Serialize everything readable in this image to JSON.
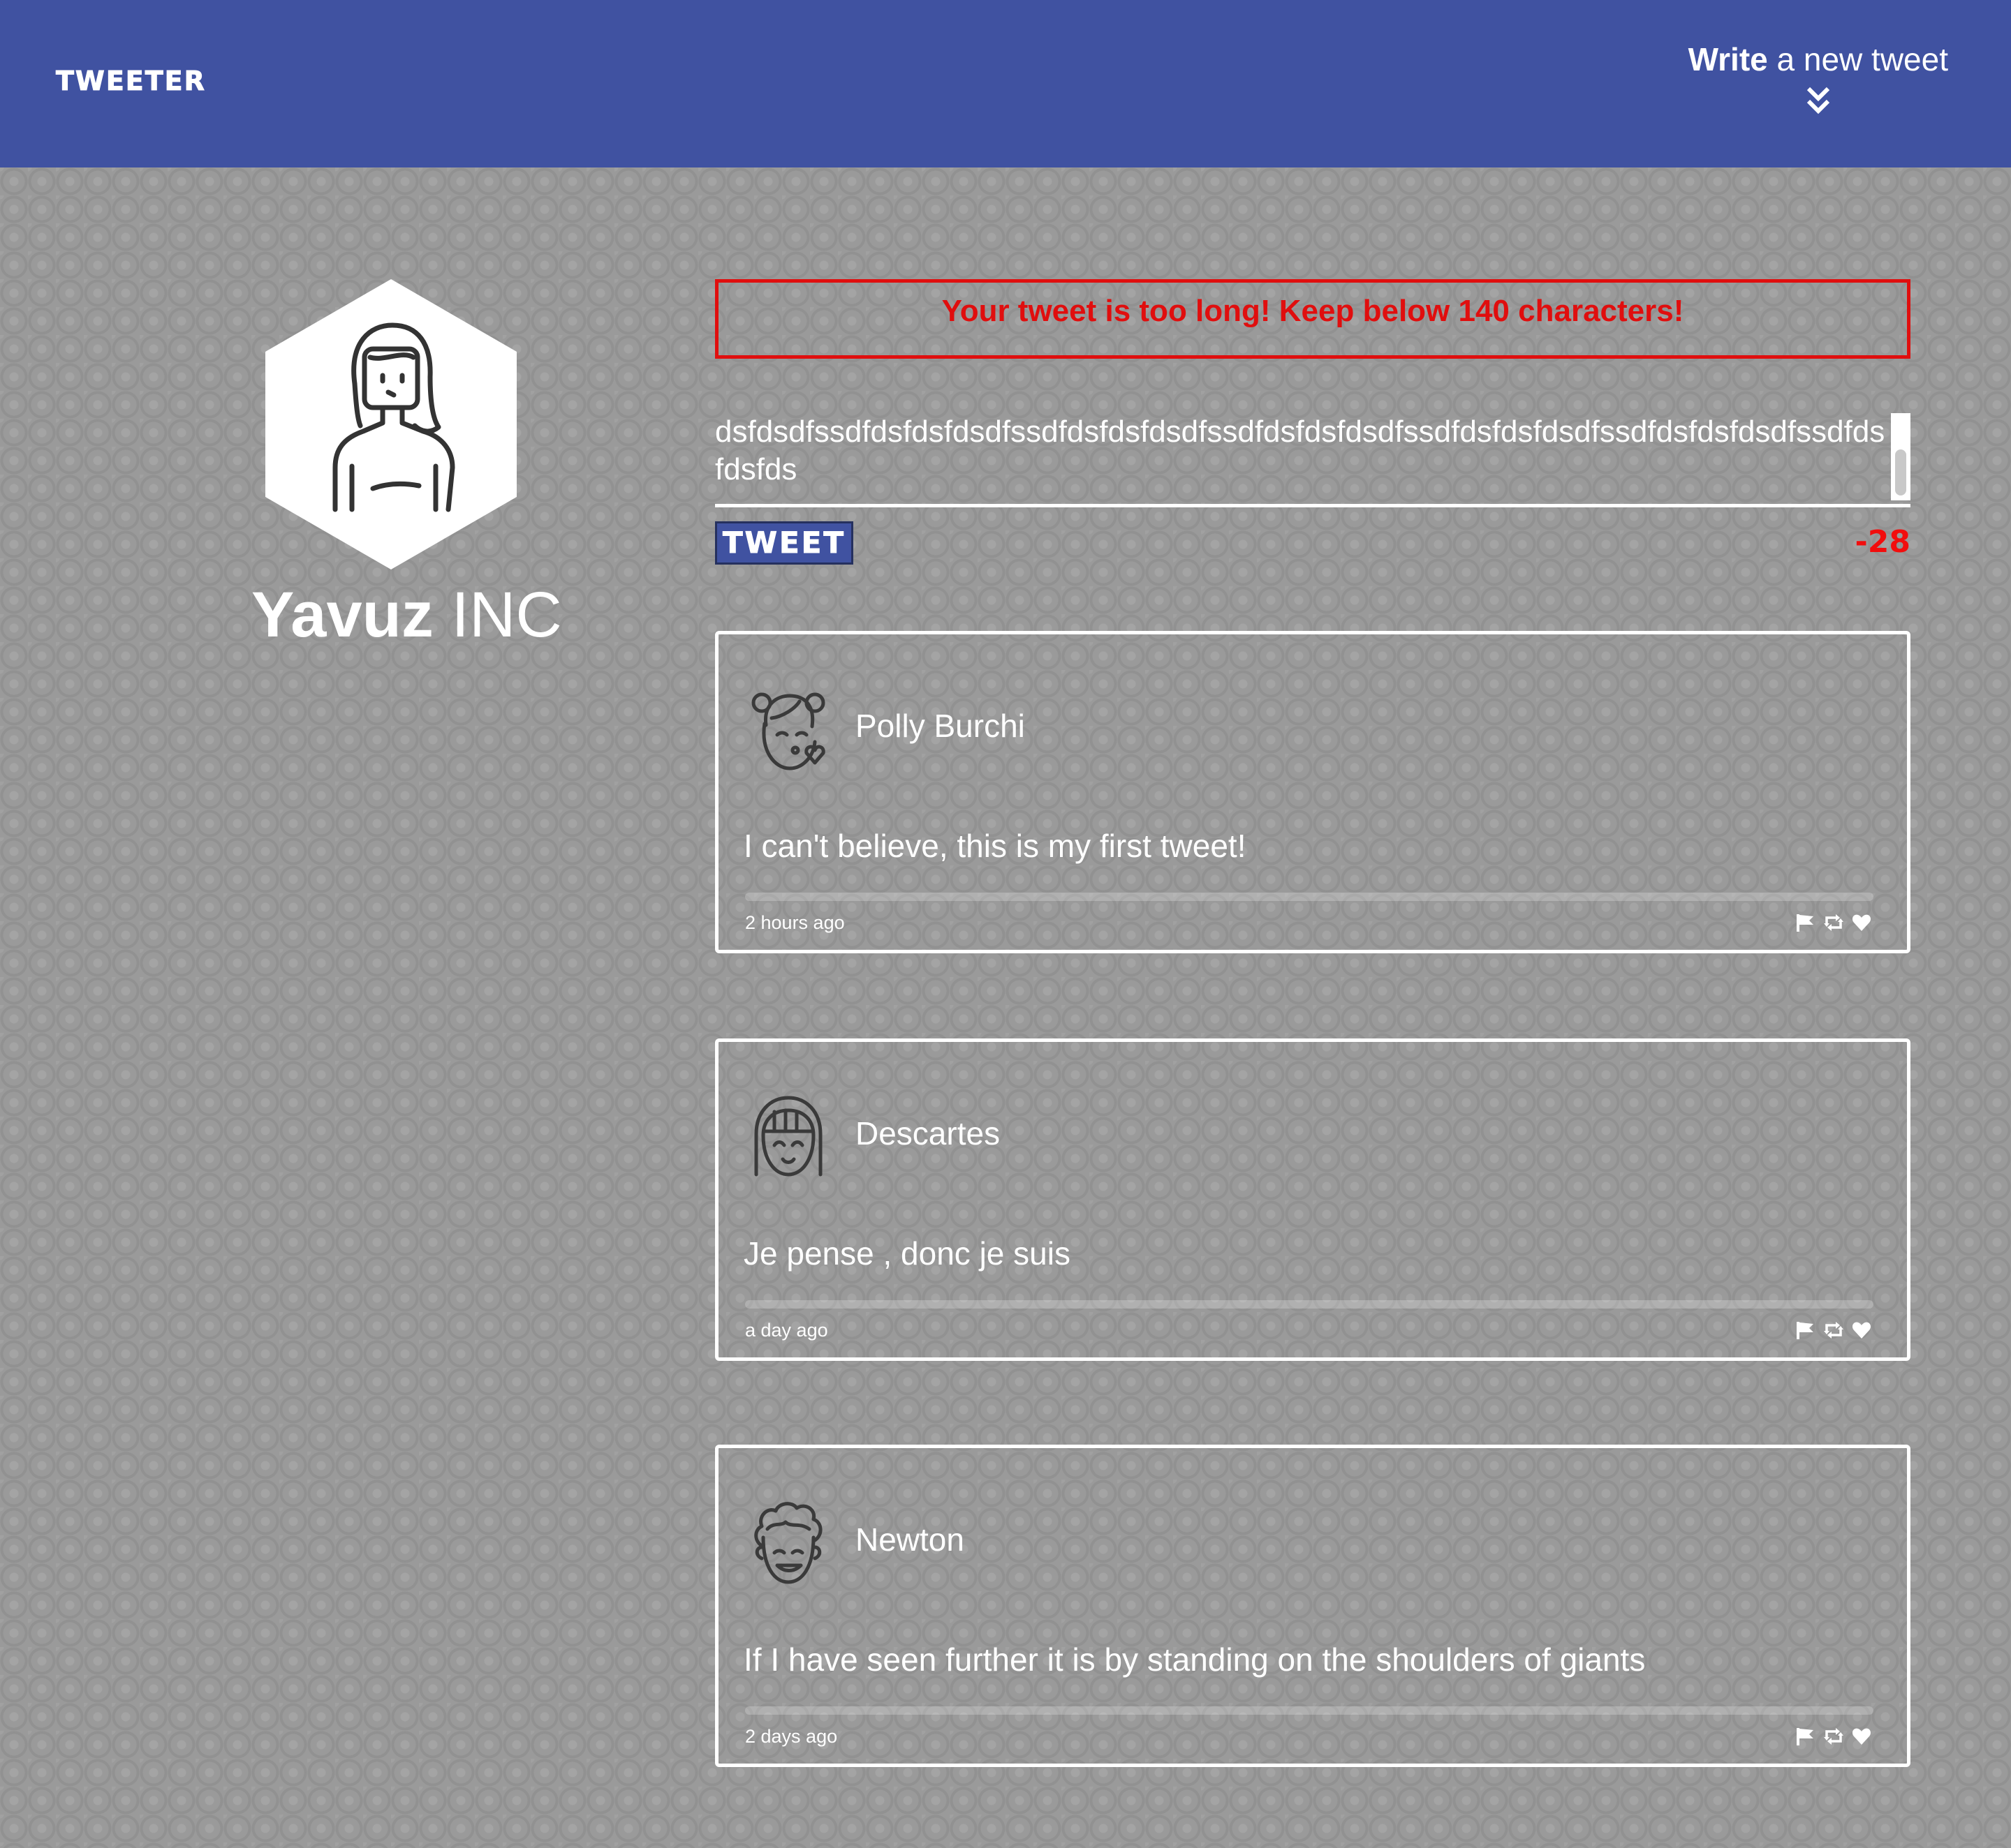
{
  "header": {
    "brand": "TWEETER",
    "compose_toggle": {
      "strong": "Write",
      "rest": " a new tweet",
      "icon": "double-chevron-down-icon"
    },
    "background_color": "#4052a1"
  },
  "profile": {
    "avatar_icon": "user-avatar-icon",
    "first_name": "Yavuz",
    "last_name": " INC"
  },
  "composer": {
    "error_message": "Your tweet is too long! Keep below 140 characters!",
    "text": "dsfdsdfssdfdsfdsfdsdfssdfdsfdsfdsdfssdfdsfdsfdsdfssdfdsfdsfdsdfssdfdsfdsfdsdfssdfdsfdsfds",
    "tweet_button_label": "TWEET",
    "char_counter": "-28",
    "error_color": "#e00e0e"
  },
  "tweets": [
    {
      "author": "Polly Burchi",
      "avatar_icon": "girl-kiss-avatar-icon",
      "content": "I can't believe, this is my first tweet!",
      "time": "2 hours ago"
    },
    {
      "author": "Descartes",
      "avatar_icon": "bob-haircut-avatar-icon",
      "content": "Je pense , donc je suis",
      "time": "a day ago"
    },
    {
      "author": "Newton",
      "avatar_icon": "curly-hair-avatar-icon",
      "content": "If I have seen further it is by standing on the shoulders of giants",
      "time": "2 days ago"
    }
  ],
  "tweet_actions": [
    "flag-icon",
    "retweet-icon",
    "heart-icon"
  ]
}
